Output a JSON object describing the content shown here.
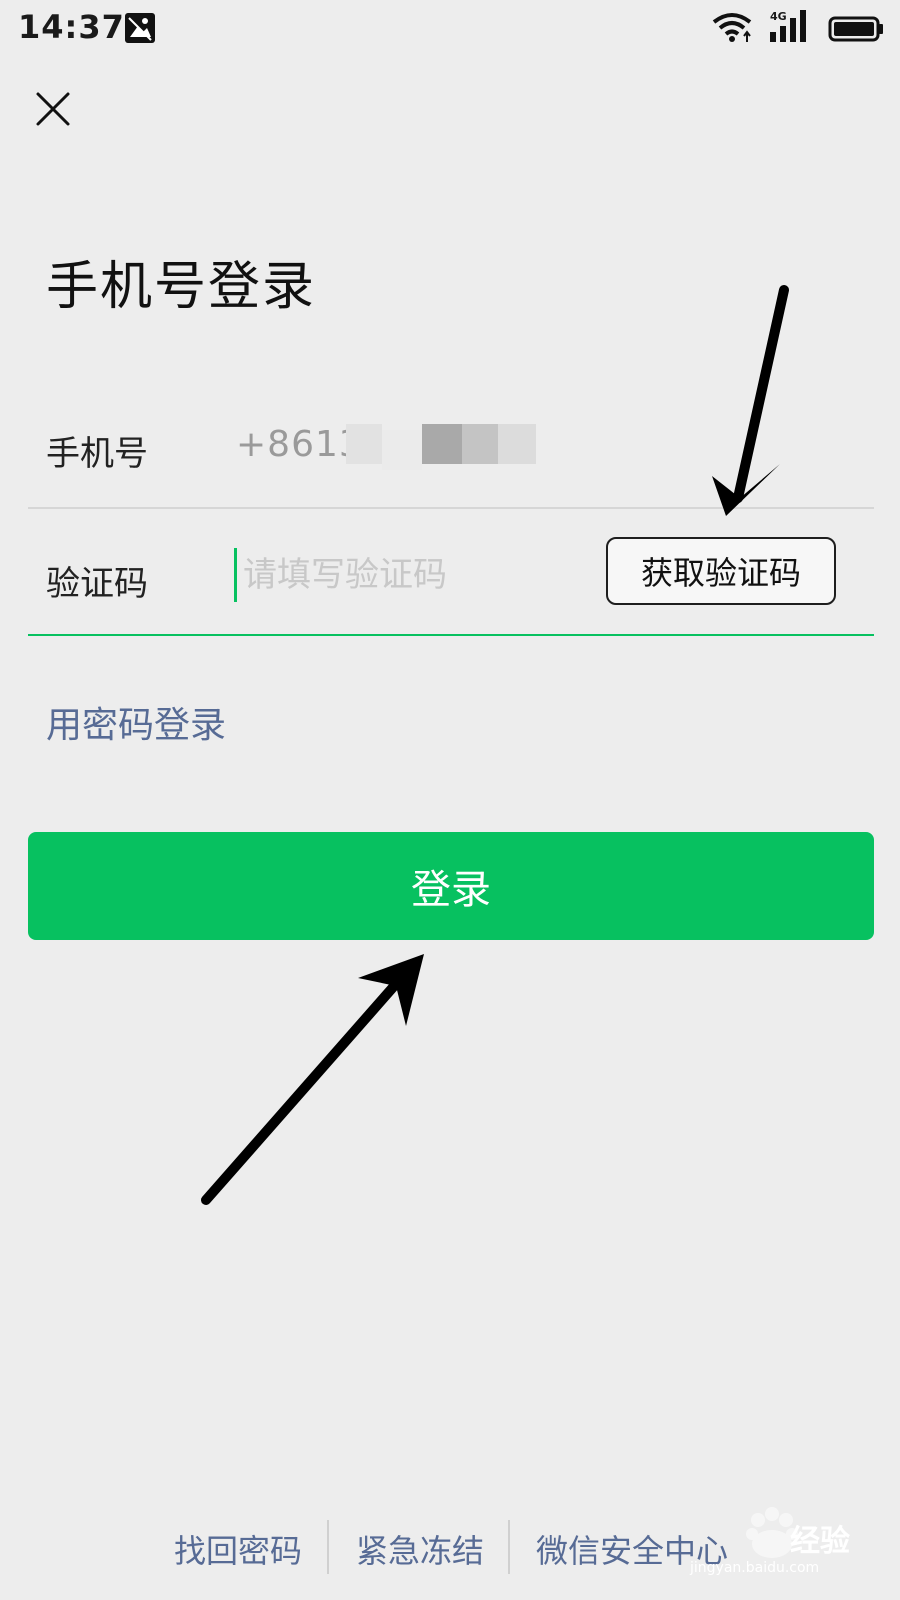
{
  "status_bar": {
    "time": "14:37",
    "network_type": "4G",
    "icons": [
      "photo-icon",
      "wifi-icon",
      "signal-icon",
      "battery-icon"
    ]
  },
  "header": {
    "close_icon": "close-icon",
    "title": "手机号登录"
  },
  "form": {
    "phone": {
      "label": "手机号",
      "value": "+8613"
    },
    "code": {
      "label": "验证码",
      "placeholder": "请填写验证码",
      "button_label": "获取验证码"
    }
  },
  "links": {
    "password_login": "用密码登录"
  },
  "actions": {
    "login_label": "登录"
  },
  "footer": {
    "items": [
      "找回密码",
      "紧急冻结",
      "微信安全中心"
    ]
  },
  "watermark": {
    "text": "经验",
    "url": "jingyan.baidu.com"
  },
  "colors": {
    "background": "#ededed",
    "primary_green": "#07c160",
    "link_blue": "#576b95",
    "text_dark": "#1a1a1a",
    "placeholder": "#c8c8c8"
  }
}
